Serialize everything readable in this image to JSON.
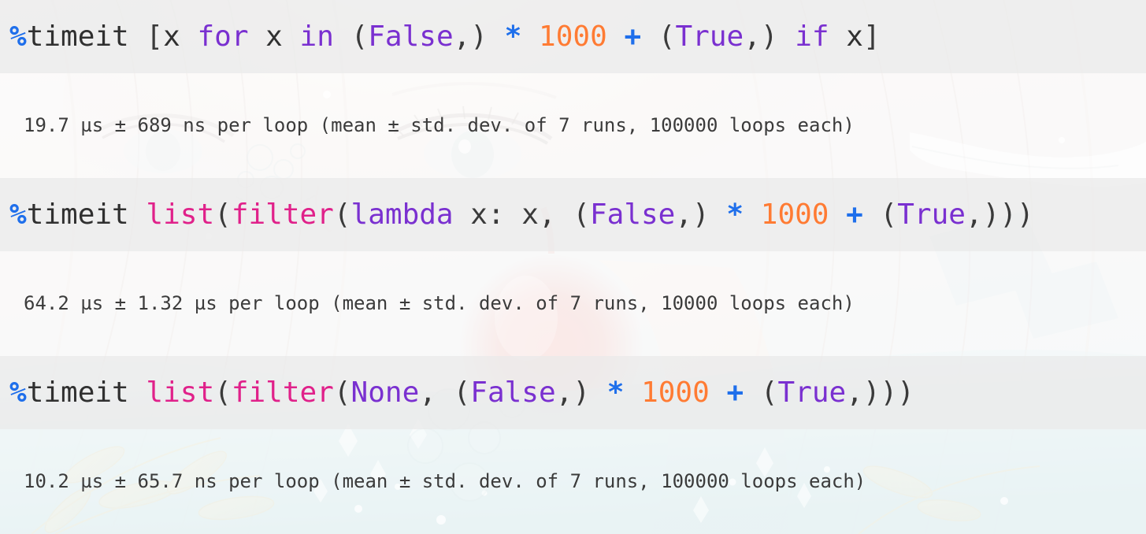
{
  "app": {
    "kind": "jupyter-notebook-cells",
    "background_note": "faded anime illustration wallpaper behind translucent notebook cells"
  },
  "colors": {
    "input_cell_bg": "#ededed",
    "output_cell_bg": "#ffffff",
    "magic": "#1f6feb",
    "operator": "#1f6feb",
    "keyword": "#7a30d0",
    "constant": "#7a30d0",
    "builtin": "#e0218a",
    "number": "#ff7b33",
    "plain_text": "#303030"
  },
  "cells": [
    {
      "type": "input",
      "prompt": "%timeit",
      "code_plain": "%timeit [x for x in (False,) * 1000 + (True,) if x]",
      "tokens": [
        {
          "t": "%",
          "c": "magic"
        },
        {
          "t": "timeit",
          "c": "plain"
        },
        {
          "t": " [",
          "c": "punct"
        },
        {
          "t": "x",
          "c": "plain"
        },
        {
          "t": " ",
          "c": "plain"
        },
        {
          "t": "for",
          "c": "keyword"
        },
        {
          "t": " x ",
          "c": "plain"
        },
        {
          "t": "in",
          "c": "keyword"
        },
        {
          "t": " (",
          "c": "punct"
        },
        {
          "t": "False",
          "c": "constant"
        },
        {
          "t": ",)",
          "c": "punct"
        },
        {
          "t": " ",
          "c": "plain"
        },
        {
          "t": "*",
          "c": "operator"
        },
        {
          "t": " ",
          "c": "plain"
        },
        {
          "t": "1000",
          "c": "number"
        },
        {
          "t": " ",
          "c": "plain"
        },
        {
          "t": "+",
          "c": "operator"
        },
        {
          "t": " (",
          "c": "punct"
        },
        {
          "t": "True",
          "c": "constant"
        },
        {
          "t": ",)",
          "c": "punct"
        },
        {
          "t": " ",
          "c": "plain"
        },
        {
          "t": "if",
          "c": "keyword"
        },
        {
          "t": " x",
          "c": "plain"
        },
        {
          "t": "]",
          "c": "punct"
        }
      ]
    },
    {
      "type": "output",
      "text": "19.7 µs ± 689 ns per loop (mean ± std. dev. of 7 runs, 100000 loops each)",
      "measurement": {
        "mean": "19.7 µs",
        "std_dev": "689 ns",
        "runs": "7",
        "loops": "100000"
      }
    },
    {
      "type": "input",
      "prompt": "%timeit",
      "code_plain": "%timeit list(filter(lambda x: x, (False,) * 1000 + (True,)))",
      "tokens": [
        {
          "t": "%",
          "c": "magic"
        },
        {
          "t": "timeit",
          "c": "plain"
        },
        {
          "t": " ",
          "c": "plain"
        },
        {
          "t": "list",
          "c": "builtin"
        },
        {
          "t": "(",
          "c": "punct"
        },
        {
          "t": "filter",
          "c": "builtin"
        },
        {
          "t": "(",
          "c": "punct"
        },
        {
          "t": "lambda",
          "c": "keyword"
        },
        {
          "t": " x: x, (",
          "c": "punct"
        },
        {
          "t": "False",
          "c": "constant"
        },
        {
          "t": ",)",
          "c": "punct"
        },
        {
          "t": " ",
          "c": "plain"
        },
        {
          "t": "*",
          "c": "operator"
        },
        {
          "t": " ",
          "c": "plain"
        },
        {
          "t": "1000",
          "c": "number"
        },
        {
          "t": " ",
          "c": "plain"
        },
        {
          "t": "+",
          "c": "operator"
        },
        {
          "t": " (",
          "c": "punct"
        },
        {
          "t": "True",
          "c": "constant"
        },
        {
          "t": ",)))",
          "c": "punct"
        }
      ]
    },
    {
      "type": "output",
      "text": "64.2 µs ± 1.32 µs per loop (mean ± std. dev. of 7 runs, 10000 loops each)",
      "measurement": {
        "mean": "64.2 µs",
        "std_dev": "1.32 µs",
        "runs": "7",
        "loops": "10000"
      }
    },
    {
      "type": "input",
      "prompt": "%timeit",
      "code_plain": "%timeit list(filter(None, (False,) * 1000 + (True,)))",
      "tokens": [
        {
          "t": "%",
          "c": "magic"
        },
        {
          "t": "timeit",
          "c": "plain"
        },
        {
          "t": " ",
          "c": "plain"
        },
        {
          "t": "list",
          "c": "builtin"
        },
        {
          "t": "(",
          "c": "punct"
        },
        {
          "t": "filter",
          "c": "builtin"
        },
        {
          "t": "(",
          "c": "punct"
        },
        {
          "t": "None",
          "c": "constant"
        },
        {
          "t": ", (",
          "c": "punct"
        },
        {
          "t": "False",
          "c": "constant"
        },
        {
          "t": ",)",
          "c": "punct"
        },
        {
          "t": " ",
          "c": "plain"
        },
        {
          "t": "*",
          "c": "operator"
        },
        {
          "t": " ",
          "c": "plain"
        },
        {
          "t": "1000",
          "c": "number"
        },
        {
          "t": " ",
          "c": "plain"
        },
        {
          "t": "+",
          "c": "operator"
        },
        {
          "t": " (",
          "c": "punct"
        },
        {
          "t": "True",
          "c": "constant"
        },
        {
          "t": ",)))",
          "c": "punct"
        }
      ]
    },
    {
      "type": "output",
      "text": "10.2 µs ± 65.7 ns per loop (mean ± std. dev. of 7 runs, 100000 loops each)",
      "measurement": {
        "mean": "10.2 µs",
        "std_dev": "65.7 ns",
        "runs": "7",
        "loops": "100000"
      }
    }
  ]
}
